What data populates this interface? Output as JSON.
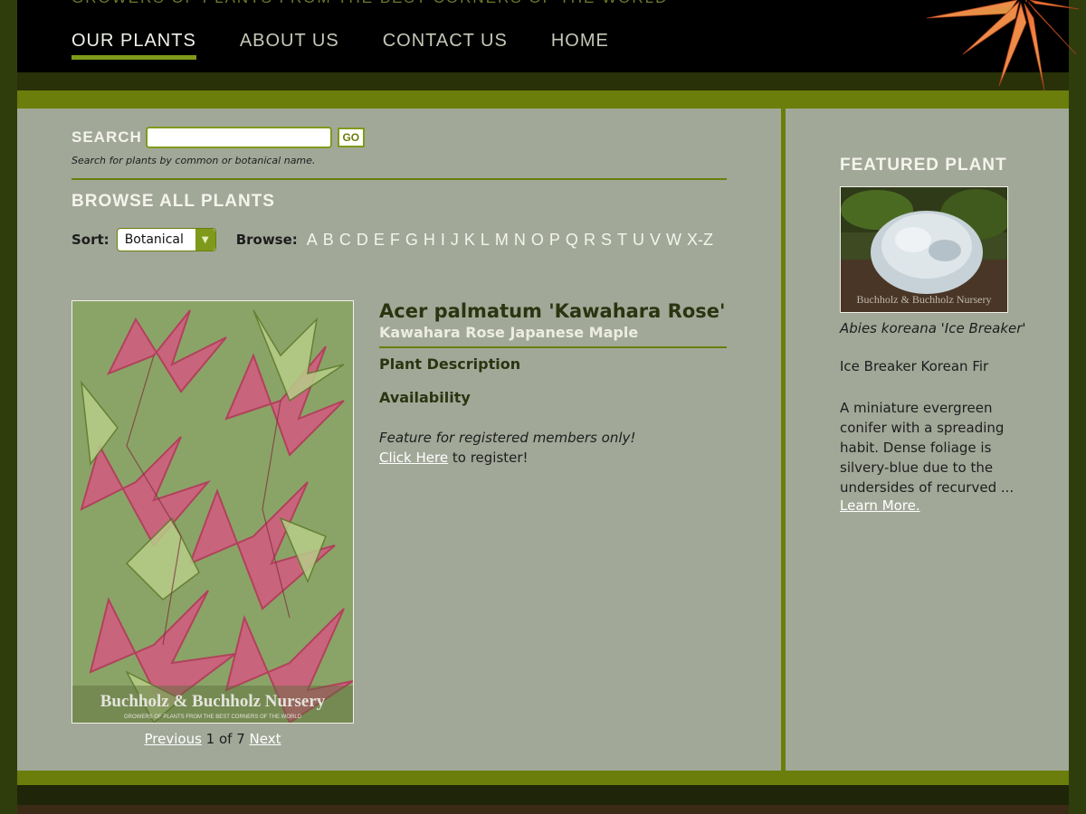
{
  "header": {
    "tagline": "GROWERS OF PLANTS FROM THE BEST CORNERS OF THE WORLD",
    "nav": [
      {
        "label": "OUR PLANTS",
        "active": true
      },
      {
        "label": "ABOUT US",
        "active": false
      },
      {
        "label": "CONTACT US",
        "active": false
      },
      {
        "label": "HOME",
        "active": false
      }
    ]
  },
  "search": {
    "label": "SEARCH",
    "value": "",
    "placeholder": "",
    "button": "GO",
    "help": "Search for plants by common or botanical name."
  },
  "browse": {
    "title": "BROWSE ALL PLANTS",
    "sort_label": "Sort:",
    "sort_value": "Botanical",
    "browse_label": "Browse:",
    "letters": [
      "A",
      "B",
      "C",
      "D",
      "E",
      "F",
      "G",
      "H",
      "I",
      "J",
      "K",
      "L",
      "M",
      "N",
      "O",
      "P",
      "Q",
      "R",
      "S",
      "T",
      "U",
      "V",
      "W",
      "X-Z"
    ]
  },
  "plant": {
    "botanical_name": "Acer palmatum 'Kawahara Rose'",
    "common_name": "Kawahara Rose Japanese Maple",
    "description_heading": "Plant Description",
    "availability_heading": "Availability",
    "member_note": "Feature for registered members only!",
    "register_link": "Click Here",
    "register_suffix": " to register!",
    "image_watermark": "Buchholz & Buchholz Nursery",
    "image_watermark_sub": "GROWERS OF PLANTS FROM THE BEST CORNERS OF THE WORLD"
  },
  "pager": {
    "previous": "Previous",
    "status": " 1 of 7 ",
    "next": "Next"
  },
  "featured": {
    "title": "FEATURED PLANT",
    "botanical_name": "Abies koreana 'Ice Breaker'",
    "common_name": "Ice Breaker Korean Fir",
    "description": "A miniature evergreen conifer with a spreading habit. Dense foliage is silvery-blue due to the undersides of recurved ...",
    "learn_more": "Learn More.",
    "image_watermark": "Buchholz & Buchholz Nursery"
  },
  "colors": {
    "accent_green": "#6b7d0a",
    "content_bg": "#a2a898",
    "header_bg": "#000000"
  }
}
